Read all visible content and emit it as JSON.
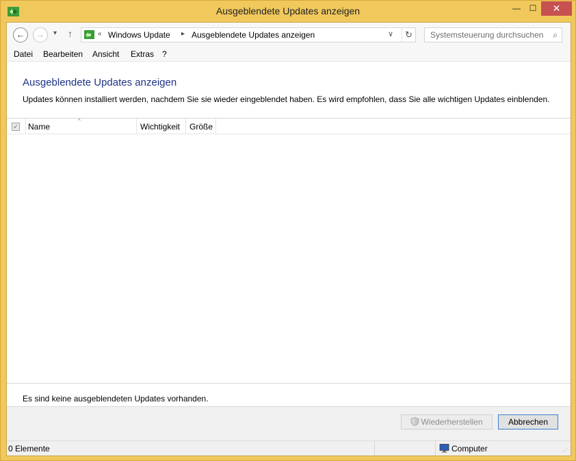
{
  "window": {
    "title": "Ausgeblendete Updates anzeigen",
    "minimize": "—",
    "maximize": "☐",
    "close": "✕"
  },
  "nav": {
    "back": "←",
    "forward": "→",
    "recent": "▾",
    "up": "↑",
    "overflow": "«",
    "breadcrumbs": [
      "Windows Update",
      "Ausgeblendete Updates anzeigen"
    ],
    "separator": "▸",
    "dropdown": "∨",
    "refresh": "↻",
    "search_placeholder": "Systemsteuerung durchsuchen",
    "search_glyph": "⌕"
  },
  "menu": [
    "Datei",
    "Bearbeiten",
    "Ansicht",
    "Extras",
    "?"
  ],
  "content": {
    "heading": "Ausgeblendete Updates anzeigen",
    "description": "Updates können installiert werden, nachdem Sie sie wieder eingeblendet haben. Es wird empfohlen, dass Sie alle wichtigen Updates einblenden.",
    "columns": [
      "Name",
      "Wichtigkeit",
      "Größe"
    ],
    "header_checked": true,
    "check_glyph": "✓",
    "sort_glyph": "^",
    "empty_message": "Es sind keine ausgeblendeten Updates vorhanden."
  },
  "buttons": {
    "restore": "Wiederherstellen",
    "cancel": "Abbrechen"
  },
  "statusbar": {
    "count": "0 Elemente",
    "zone": "Computer",
    "grip": "⋰"
  },
  "colors": {
    "frame": "#f0c85c",
    "heading": "#1e3287",
    "close_button": "#c75050",
    "default_button_border": "#3c7fd0"
  }
}
